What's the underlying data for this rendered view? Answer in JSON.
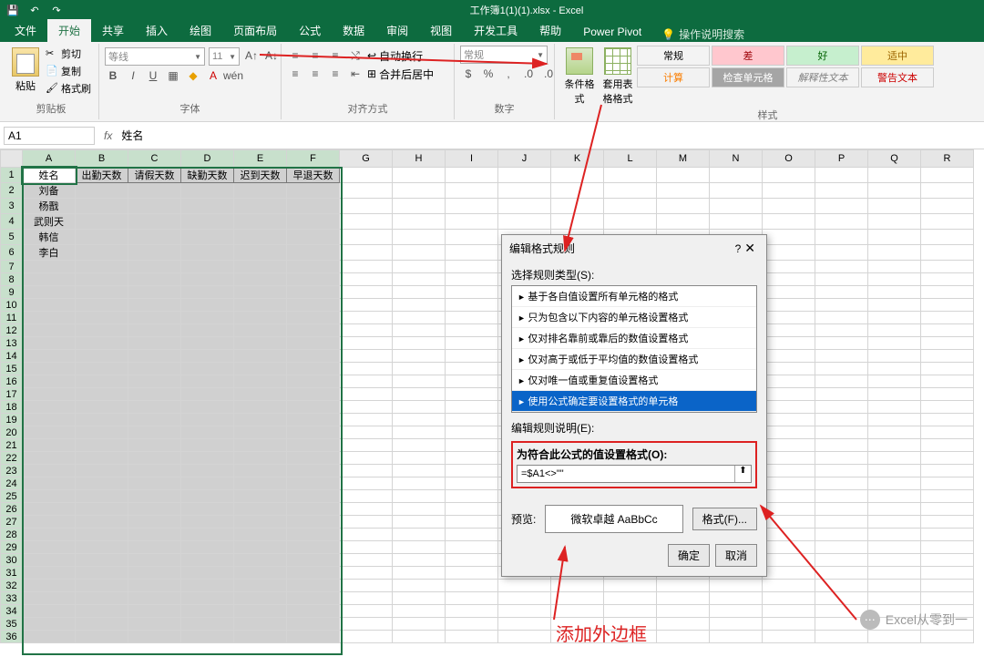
{
  "title": "工作簿1(1)(1).xlsx - Excel",
  "qat": {
    "save": "💾",
    "undo": "↶",
    "redo": "↷"
  },
  "tabs": {
    "file": "文件",
    "home": "开始",
    "share": "共享",
    "insert": "插入",
    "draw": "绘图",
    "layout": "页面布局",
    "formula": "公式",
    "data": "数据",
    "review": "审阅",
    "view": "视图",
    "dev": "开发工具",
    "help": "帮助",
    "pivot": "Power Pivot",
    "tellme": "操作说明搜索"
  },
  "ribbon": {
    "clipboard": {
      "paste": "粘贴",
      "cut": "剪切",
      "copy": "复制",
      "painter": "格式刷",
      "label": "剪贴板"
    },
    "font": {
      "name_ph": "等线",
      "size_ph": "11",
      "label": "字体"
    },
    "align": {
      "wrap": "自动换行",
      "merge": "合并后居中",
      "label": "对齐方式"
    },
    "number": {
      "general": "常规",
      "label": "数字"
    },
    "styles": {
      "cond": "条件格式",
      "table": "套用表格格式",
      "label": "样式",
      "normal": "常规",
      "bad": "差",
      "good": "好",
      "neutral": "适中",
      "calc": "计算",
      "check": "检查单元格",
      "explan": "解释性文本",
      "warn": "警告文本"
    }
  },
  "namebox": "A1",
  "formula_value": "姓名",
  "columns": [
    "A",
    "B",
    "C",
    "D",
    "E",
    "F",
    "G",
    "H",
    "I",
    "J",
    "K",
    "L",
    "M",
    "N",
    "O",
    "P",
    "Q",
    "R"
  ],
  "headers": [
    "姓名",
    "出勤天数",
    "请假天数",
    "缺勤天数",
    "迟到天数",
    "早退天数"
  ],
  "names": [
    "刘备",
    "杨戬",
    "武则天",
    "韩信",
    "李白"
  ],
  "dialog": {
    "title": "编辑格式规则",
    "select_label": "选择规则类型(S):",
    "rules": [
      "基于各自值设置所有单元格的格式",
      "只为包含以下内容的单元格设置格式",
      "仅对排名靠前或靠后的数值设置格式",
      "仅对高于或低于平均值的数值设置格式",
      "仅对唯一值或重复值设置格式",
      "使用公式确定要设置格式的单元格"
    ],
    "edit_label": "编辑规则说明(E):",
    "formula_label": "为符合此公式的值设置格式(O):",
    "formula_value": "=$A1<>\"\"",
    "preview": "预览:",
    "preview_text": "微软卓越 AaBbCc",
    "format_btn": "格式(F)...",
    "ok": "确定",
    "cancel": "取消"
  },
  "annotation": "添加外边框",
  "watermark": "Excel从零到一"
}
